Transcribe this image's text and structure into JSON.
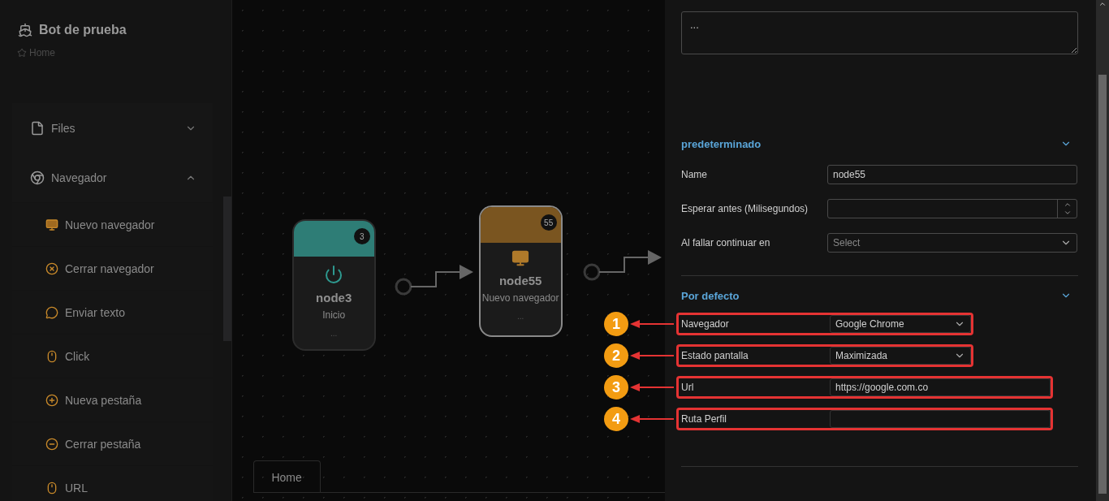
{
  "sidebar": {
    "title": "Bot de prueba",
    "breadcrumb": "Home",
    "groups": [
      {
        "label": "Files",
        "kind": "file",
        "expanded": false
      },
      {
        "label": "Navegador",
        "kind": "browser",
        "expanded": true,
        "items": [
          {
            "label": "Nuevo navegador",
            "kind": "monitor"
          },
          {
            "label": "Cerrar navegador",
            "kind": "close"
          },
          {
            "label": "Enviar texto",
            "kind": "chat"
          },
          {
            "label": "Click",
            "kind": "mouse"
          },
          {
            "label": "Nueva pestaña",
            "kind": "plus"
          },
          {
            "label": "Cerrar pestaña",
            "kind": "minus"
          },
          {
            "label": "URL",
            "kind": "mouse"
          }
        ]
      }
    ]
  },
  "canvas": {
    "nodes": [
      {
        "title": "node3",
        "subtitle": "Inicio",
        "badge": "3",
        "footer": "...",
        "kind": "start",
        "color": "#2e7d76",
        "selected": false
      },
      {
        "title": "node55",
        "subtitle": "Nuevo navegador",
        "badge": "55",
        "footer": "...",
        "kind": "monitor",
        "color": "#7a5520",
        "selected": true
      }
    ],
    "tabs": [
      {
        "label": "Home",
        "selected": true
      }
    ]
  },
  "panel": {
    "description": "...",
    "sections": [
      {
        "title": "predeterminado",
        "expanded": true,
        "fields": [
          {
            "label": "Name",
            "kind": "text",
            "value": "node55"
          },
          {
            "label": "Esperar antes (Milisegundos)",
            "kind": "number"
          },
          {
            "label": "Al fallar continuar en",
            "kind": "select",
            "placeholder": "Select"
          }
        ]
      },
      {
        "title": "Por defecto",
        "expanded": true,
        "fields": [
          {
            "label": "Navegador",
            "kind": "select",
            "value": "Google Chrome",
            "callout": "1"
          },
          {
            "label": "Estado pantalla",
            "kind": "select",
            "value": "Maximizada",
            "callout": "2"
          },
          {
            "label": "Url",
            "kind": "text",
            "value": "https://google.com.co",
            "callout": "3"
          },
          {
            "label": "Ruta Perfil",
            "kind": "text",
            "callout": "4"
          }
        ]
      }
    ]
  }
}
